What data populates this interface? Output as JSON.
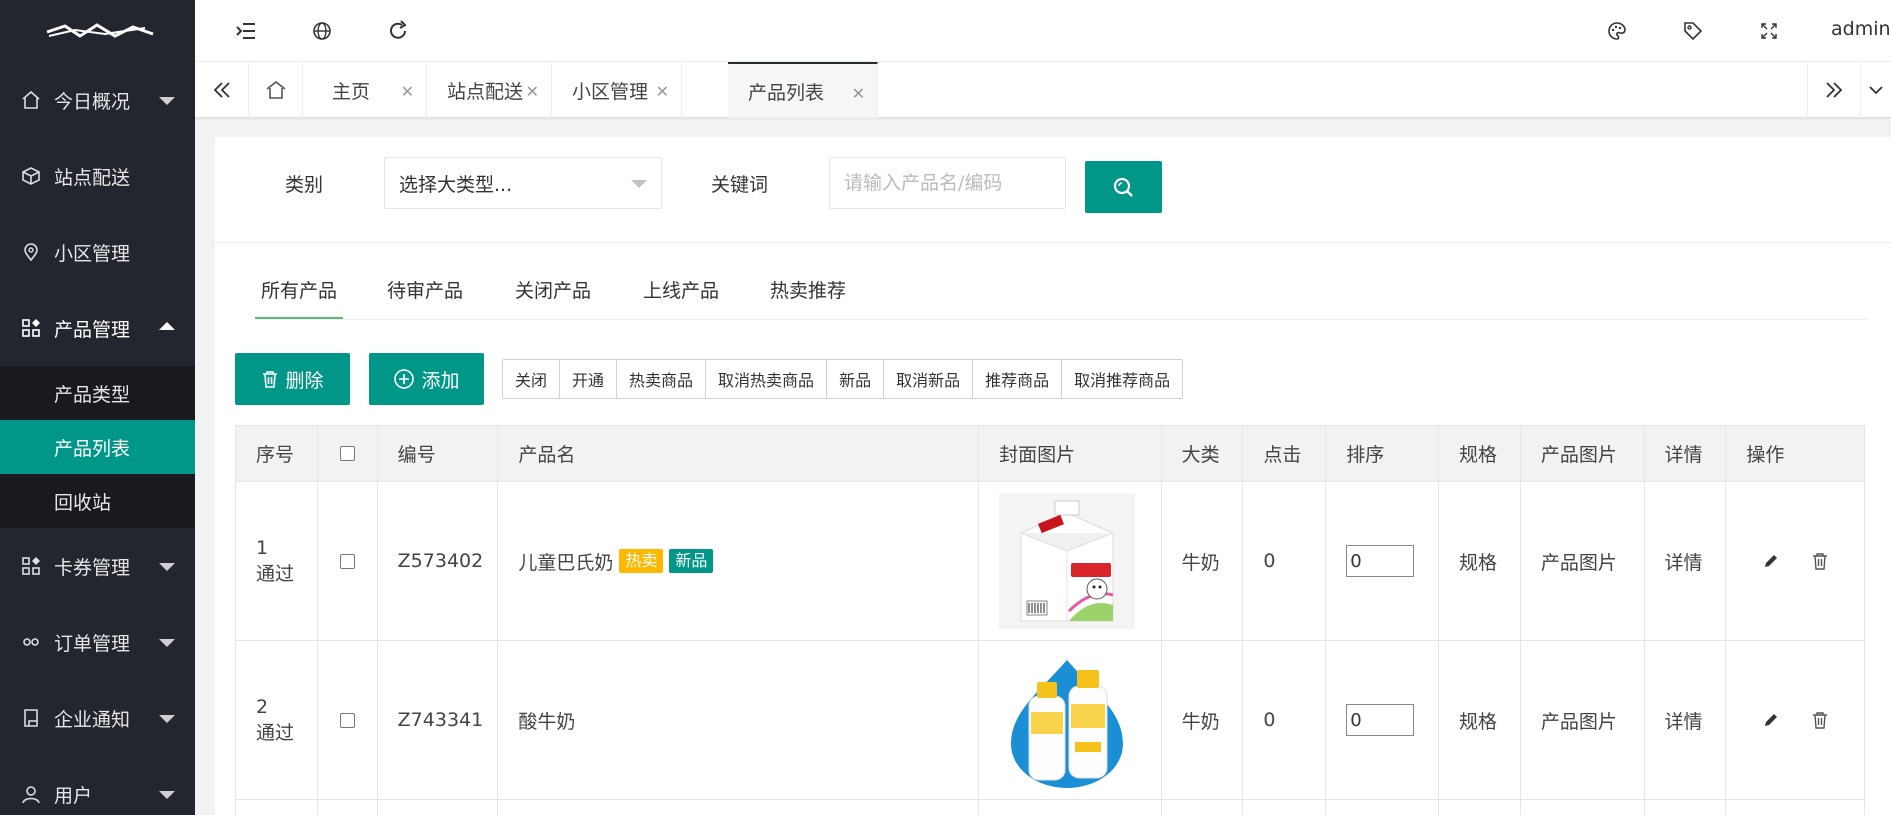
{
  "sidebar": {
    "logo": "",
    "items": [
      {
        "label": "今日概况",
        "icon": "home-icon"
      },
      {
        "label": "站点配送",
        "icon": "box-icon"
      },
      {
        "label": "小区管理",
        "icon": "location-icon"
      },
      {
        "label": "产品管理",
        "icon": "apps-icon",
        "open": true
      },
      {
        "label": "卡券管理",
        "icon": "apps-icon"
      },
      {
        "label": "订单管理",
        "icon": "link-icon"
      },
      {
        "label": "企业通知",
        "icon": "note-icon"
      },
      {
        "label": "用户",
        "icon": "user-icon"
      }
    ],
    "subitems": [
      {
        "label": "产品类型"
      },
      {
        "label": "产品列表",
        "active": true
      },
      {
        "label": "回收站"
      }
    ]
  },
  "header": {
    "user": "admin"
  },
  "tabs": [
    {
      "label": "主页"
    },
    {
      "label": "站点配送"
    },
    {
      "label": "小区管理"
    },
    {
      "label": "产品列表",
      "active": true
    }
  ],
  "filters": {
    "category_label": "类别",
    "category_value": "选择大类型...",
    "keyword_label": "关键词",
    "keyword_placeholder": "请输入产品名/编码"
  },
  "subtabs": [
    "所有产品",
    "待审产品",
    "关闭产品",
    "上线产品",
    "热卖推荐"
  ],
  "actions": {
    "delete": "删除",
    "add": "添加",
    "group": [
      "关闭",
      "开通",
      "热卖商品",
      "取消热卖商品",
      "新品",
      "取消新品",
      "推荐商品",
      "取消推荐商品"
    ]
  },
  "table": {
    "headers": [
      "序号",
      "",
      "编号",
      "产品名",
      "封面图片",
      "大类",
      "点击",
      "排序",
      "规格",
      "产品图片",
      "详情",
      "操作"
    ],
    "rows": [
      {
        "seq": "1",
        "status": "通过",
        "code": "Z573402",
        "name": "儿童巴氏奶",
        "badges": [
          "热卖",
          "新品"
        ],
        "category": "牛奶",
        "clicks": "0",
        "sort": "0",
        "spec": "规格",
        "images": "产品图片",
        "detail": "详情"
      },
      {
        "seq": "2",
        "status": "通过",
        "code": "Z743341",
        "name": "酸牛奶",
        "badges": [],
        "category": "牛奶",
        "clicks": "0",
        "sort": "0",
        "spec": "规格",
        "images": "产品图片",
        "detail": "详情"
      }
    ]
  },
  "colors": {
    "sidebar_bg": "#23262e",
    "accent": "#009688",
    "badge_hot": "#ffb800"
  }
}
